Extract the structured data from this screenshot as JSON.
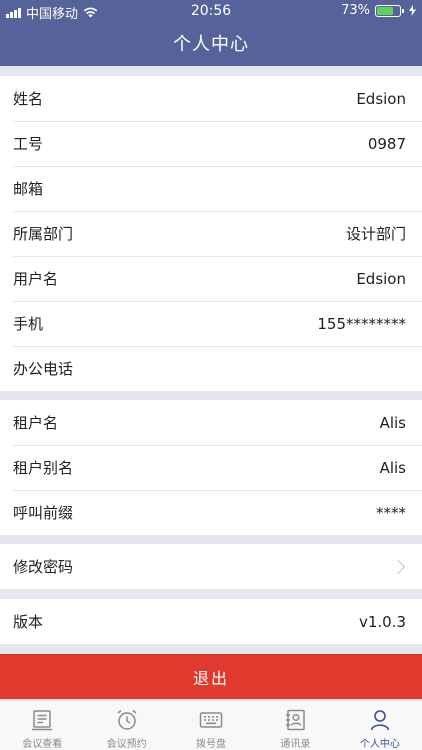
{
  "status_bar": {
    "carrier": "中国移动",
    "time": "20:56",
    "battery_percent": "73%",
    "battery_level": 0.73
  },
  "header": {
    "title": "个人中心"
  },
  "profile": [
    {
      "label": "姓名",
      "value": "Edsion"
    },
    {
      "label": "工号",
      "value": "0987"
    },
    {
      "label": "邮箱",
      "value": ""
    },
    {
      "label": "所属部门",
      "value": "设计部门"
    },
    {
      "label": "用户名",
      "value": "Edsion"
    },
    {
      "label": "手机",
      "value": "155********"
    },
    {
      "label": "办公电话",
      "value": ""
    }
  ],
  "tenant": [
    {
      "label": "租户名",
      "value": "Alis"
    },
    {
      "label": "租户别名",
      "value": "Alis"
    },
    {
      "label": "呼叫前缀",
      "value": "****"
    }
  ],
  "password": {
    "label": "修改密码"
  },
  "version": {
    "label": "版本",
    "value": "v1.0.3"
  },
  "logout": {
    "label": "退出"
  },
  "tabs": [
    {
      "label": "会议查看",
      "icon": "meeting-list-icon"
    },
    {
      "label": "会议预约",
      "icon": "alarm-clock-icon"
    },
    {
      "label": "拨号盘",
      "icon": "keypad-icon"
    },
    {
      "label": "通讯录",
      "icon": "contacts-icon"
    },
    {
      "label": "个人中心",
      "icon": "person-icon",
      "active": true
    }
  ],
  "colors": {
    "header": "#56629a",
    "logout": "#e03a2e",
    "tab_active": "#3c4f9e",
    "tab_inactive": "#8a8a8a"
  }
}
